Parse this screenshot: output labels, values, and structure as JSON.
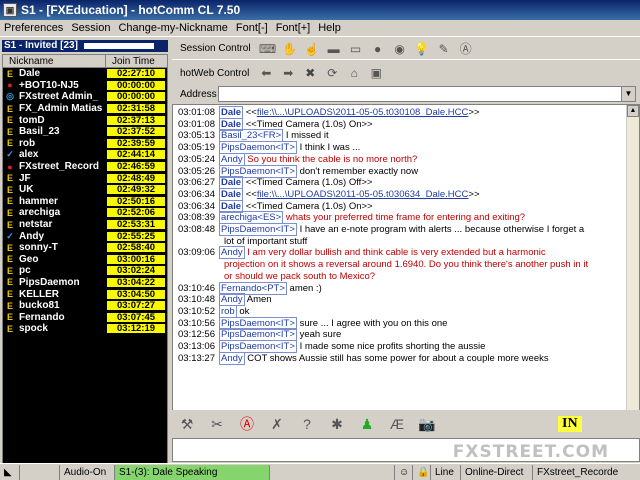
{
  "window": {
    "title": "S1 - [FXEducation] - hotComm CL 7.50",
    "app_icon": "hotcomm-app-icon"
  },
  "menu": [
    "Preferences",
    "Session",
    "Change-my-Nickname",
    "Font[-]",
    "Font[+]",
    "Help"
  ],
  "left": {
    "group_header": "S1 - Invited [23]",
    "columns": {
      "nickname": "Nickname",
      "join_time": "Join Time"
    },
    "users": [
      {
        "icon": "E",
        "name": "Dale",
        "time": "02:27:10"
      },
      {
        "icon": "●",
        "name": "+BOT10-NJ5",
        "time": "00:00:00"
      },
      {
        "icon": "◎",
        "name": "FXstreet Admin_",
        "time": "00:00:00"
      },
      {
        "icon": "E",
        "name": "FX_Admin Matias",
        "time": "02:31:58"
      },
      {
        "icon": "E",
        "name": "tomD",
        "time": "02:37:13"
      },
      {
        "icon": "E",
        "name": "Basil_23",
        "time": "02:37:52"
      },
      {
        "icon": "E",
        "name": "rob",
        "time": "02:39:59"
      },
      {
        "icon": "✓",
        "name": "alex",
        "time": "02:44:14"
      },
      {
        "icon": "●",
        "name": "FXstreet_Record",
        "time": "02:46:59"
      },
      {
        "icon": "E",
        "name": "JF",
        "time": "02:48:49"
      },
      {
        "icon": "E",
        "name": "UK",
        "time": "02:49:32"
      },
      {
        "icon": "E",
        "name": "hammer",
        "time": "02:50:16"
      },
      {
        "icon": "E",
        "name": "arechiga",
        "time": "02:52:06"
      },
      {
        "icon": "E",
        "name": "netstar",
        "time": "02:53:31"
      },
      {
        "icon": "✓",
        "name": "Andy",
        "time": "02:55:25"
      },
      {
        "icon": "E",
        "name": "sonny-T",
        "time": "02:58:40"
      },
      {
        "icon": "E",
        "name": "Geo",
        "time": "03:00:16"
      },
      {
        "icon": "E",
        "name": "pc",
        "time": "03:02:24"
      },
      {
        "icon": "E",
        "name": "PipsDaemon",
        "time": "03:04:22"
      },
      {
        "icon": "E",
        "name": "KELLER",
        "time": "03:04:50"
      },
      {
        "icon": "E",
        "name": "bucko81",
        "time": "03:07:27"
      },
      {
        "icon": "E",
        "name": "Fernando",
        "time": "03:07:45"
      },
      {
        "icon": "E",
        "name": "spock",
        "time": "03:12:19"
      }
    ]
  },
  "toolbar_session": {
    "label": "Session Control",
    "icons": [
      "keyboard-icon",
      "hand-icon",
      "hand-raise-icon",
      "folder-icon",
      "folder-open-icon",
      "person-icon",
      "user-icon",
      "bulb-icon",
      "pin-icon",
      "a-icon"
    ]
  },
  "toolbar_web": {
    "label": "hotWeb Control",
    "icons": [
      "back-arrow-icon",
      "forward-arrow-icon",
      "stop-icon",
      "refresh-icon",
      "home-icon",
      "screen-icon"
    ]
  },
  "address": {
    "label": "Address",
    "value": ""
  },
  "chat": [
    {
      "ts": "03:01:08",
      "who": "Dale",
      "dale": true,
      "pre": "<<",
      "link": "file:\\\\...\\UPLOADS\\2011-05-05.t030108_Dale.HCC",
      "post": ">>"
    },
    {
      "ts": "03:01:08",
      "who": "Dale",
      "dale": true,
      "text": "<<Timed Camera (1.0s) On>>"
    },
    {
      "ts": "03:05:13",
      "who": "Basil_23<FR>",
      "text": "I missed it"
    },
    {
      "ts": "03:05:19",
      "who": "PipsDaemon<IT>",
      "text": "I think I was ..."
    },
    {
      "ts": "03:05:24",
      "who": "Andy",
      "red": true,
      "text": "So you think the cable is no more north?"
    },
    {
      "ts": "03:05:26",
      "who": "PipsDaemon<IT>",
      "text": "don't remember exactly now"
    },
    {
      "ts": "03:06:27",
      "who": "Dale",
      "dale": true,
      "text": "<<Timed Camera (1.0s) Off>>"
    },
    {
      "ts": "03:06:34",
      "who": "Dale",
      "dale": true,
      "pre": "<<",
      "link": "file:\\\\...\\UPLOADS\\2011-05-05.t030634_Dale.HCC",
      "post": ">>"
    },
    {
      "ts": "03:06:34",
      "who": "Dale",
      "dale": true,
      "text": "<<Timed Camera (1.0s) On>>"
    },
    {
      "ts": "03:08:39",
      "who": "arechiga<ES>",
      "red": true,
      "text": "whats your preferred time frame for entering and exiting?"
    },
    {
      "ts": "03:08:48",
      "who": "PipsDaemon<IT>",
      "text": "I have an e-note program with alerts ... because otherwise I forget a"
    },
    {
      "ts": "",
      "cont": true,
      "text": "lot of important stuff"
    },
    {
      "ts": "03:09:06",
      "who": "Andy",
      "red": true,
      "text": "I am very dollar bullish and think cable is very extended but a harmonic"
    },
    {
      "ts": "",
      "cont": true,
      "red": true,
      "text": "projection on it shows a reversal around 1.6940. Do you think there's another push in it"
    },
    {
      "ts": "",
      "cont": true,
      "red": true,
      "text": "or should we pack south to Mexico?"
    },
    {
      "ts": "03:10:46",
      "who": "Fernando<PT>",
      "text": "amen :)"
    },
    {
      "ts": "03:10:48",
      "who": "Andy",
      "text": "Amen"
    },
    {
      "ts": "03:10:52",
      "who": "rob",
      "text": "ok"
    },
    {
      "ts": "03:10:56",
      "who": "PipsDaemon<IT>",
      "text": "sure ... I agree with you on this one"
    },
    {
      "ts": "03:12:56",
      "who": "PipsDaemon<IT>",
      "text": "yeah sure"
    },
    {
      "ts": "03:13:06",
      "who": "PipsDaemon<IT>",
      "text": "I made some nice profits shorting the aussie"
    },
    {
      "ts": "03:13:27",
      "who": "Andy",
      "text": "COT shows Aussie still has some power for about a couple more weeks"
    }
  ],
  "toolbar_bottom": {
    "icons": [
      "broom-icon",
      "clear-icon",
      "a-red-icon",
      "document-x-icon",
      "help-icon",
      "gear-icon",
      "person-green-icon",
      "text-icon",
      "camera-icon"
    ],
    "in_label": "IN"
  },
  "input": {
    "value": "",
    "watermark": "FXSTREET.COM"
  },
  "status": {
    "audio": "Audio-On",
    "speaking": "S1-(3): Dale Speaking",
    "line": "Line",
    "mode": "Online-Direct",
    "user": "FXstreet_Recorde"
  }
}
